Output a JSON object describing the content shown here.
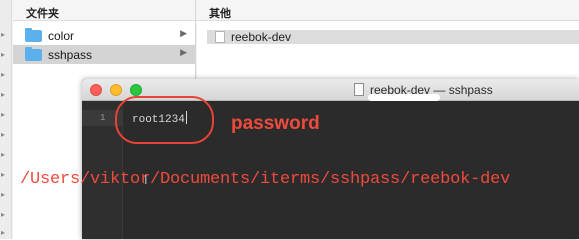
{
  "finder": {
    "column1": {
      "header": "文件夹",
      "items": [
        {
          "label": "color",
          "icon": "folder-icon",
          "selected": false
        },
        {
          "label": "sshpass",
          "icon": "folder-icon",
          "selected": true
        }
      ]
    },
    "column2": {
      "header": "其他",
      "files": [
        {
          "label": "reebok-dev",
          "icon": "document-icon",
          "selected": true
        }
      ]
    }
  },
  "editor": {
    "title": "reebok-dev — sshpass",
    "line_numbers": [
      "1"
    ],
    "lines": [
      "root1234"
    ]
  },
  "annotations": {
    "password_label": "password",
    "path": "/Users/viktor/Documents/iterms/sshpass/reebok-dev",
    "color": "#ef4a3d"
  },
  "colors": {
    "folder": "#5cb1ec",
    "editor_bg": "#2b2b2b",
    "traffic_red": "#fc5f57",
    "traffic_yellow": "#fdbc2e",
    "traffic_green": "#29c840"
  }
}
